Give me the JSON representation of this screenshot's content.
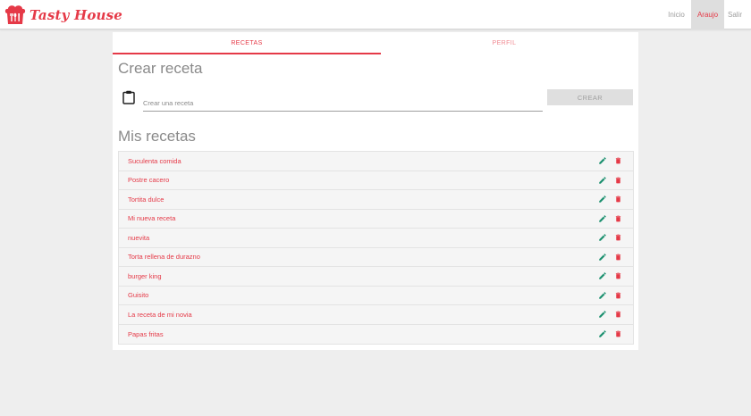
{
  "app": {
    "brand_name": "Tasty House",
    "brand_color": "#e53947",
    "logo_icon": "chef-hat-cutlery-icon"
  },
  "nav": {
    "items": [
      {
        "label": "Inicio",
        "active": false
      },
      {
        "label": "Araujo",
        "active": true
      },
      {
        "label": "Salir",
        "active": false
      }
    ]
  },
  "tabs": [
    {
      "label": "RECETAS",
      "active": true
    },
    {
      "label": "PERFIL",
      "active": false
    }
  ],
  "create": {
    "heading": "Crear receta",
    "input_placeholder": "Crear una receta",
    "input_value": "",
    "input_icon": "clipboard-icon",
    "button_label": "CREAR"
  },
  "recipes": {
    "heading": "Mis recetas",
    "edit_icon": "pencil-icon",
    "edit_color": "#1a8f6e",
    "delete_icon": "trash-icon",
    "delete_color": "#e53947",
    "items": [
      {
        "name": "Suculenta comida"
      },
      {
        "name": "Postre cacero"
      },
      {
        "name": "Tortita dulce"
      },
      {
        "name": "Mi nueva receta"
      },
      {
        "name": "nuevita"
      },
      {
        "name": "Torta rellena de durazno"
      },
      {
        "name": "burger king"
      },
      {
        "name": "Guisito"
      },
      {
        "name": "La receta de mi novia"
      },
      {
        "name": "Papas fritas"
      }
    ]
  }
}
